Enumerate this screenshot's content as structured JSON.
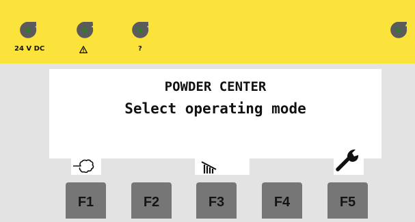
{
  "indicators": [
    {
      "number": "1",
      "label": "24 V DC",
      "icon": "led-24v-icon"
    },
    {
      "number": "2",
      "label": "",
      "icon": "warning-icon"
    },
    {
      "number": "3",
      "label": "?",
      "icon": "led-question-icon"
    },
    {
      "number": "4",
      "label": "",
      "icon": "led-icon"
    }
  ],
  "screen": {
    "line1": "POWDER CENTER",
    "line2": "Select operating mode"
  },
  "softkey_icons": [
    "powder-cloud-icon",
    "",
    "cleaning-rake-icon",
    "",
    "wrench-icon"
  ],
  "function_keys": [
    "F1",
    "F2",
    "F3",
    "F4",
    "F5"
  ],
  "colors": {
    "panel_yellow": "#fce33b",
    "panel_grey": "#e3e3e3",
    "led_grey": "#5b5b5b",
    "led_green": "#2f7d2b",
    "key_grey": "#767676"
  }
}
